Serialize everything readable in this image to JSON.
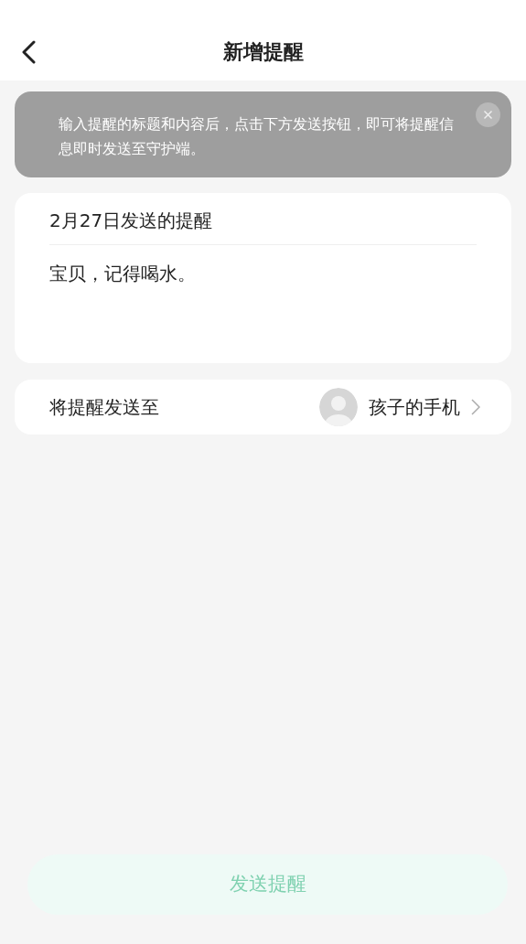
{
  "header": {
    "title": "新增提醒"
  },
  "notice": {
    "text": "输入提醒的标题和内容后，点击下方发送按钮，即可将提醒信息即时发送至守护端。"
  },
  "reminder": {
    "title": "2月27日发送的提醒",
    "content": "宝贝，记得喝水。"
  },
  "recipient": {
    "label": "将提醒发送至",
    "device": "孩子的手机"
  },
  "send_button": {
    "label": "发送提醒",
    "disabled": true
  }
}
